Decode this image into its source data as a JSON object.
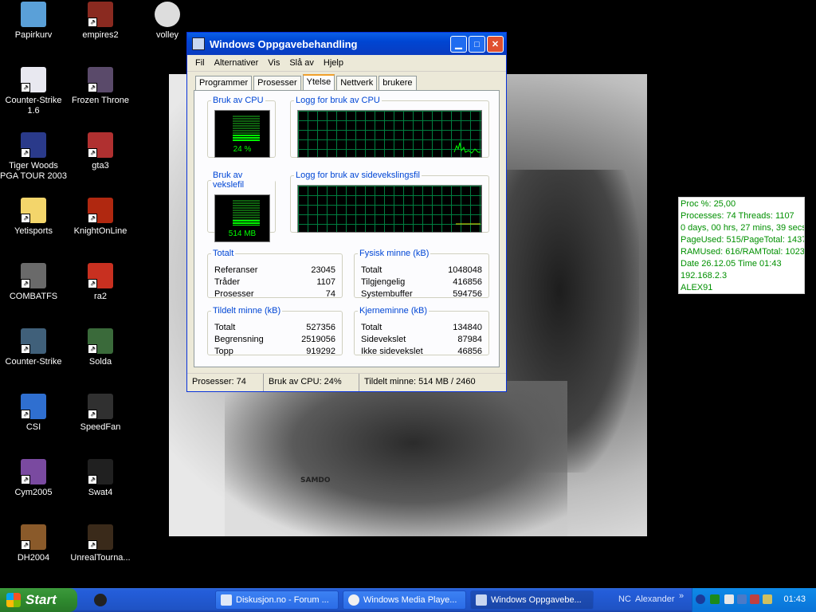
{
  "desktop": {
    "icons": [
      {
        "label": "Papirkurv",
        "icon": "recycle-bin-icon",
        "color": "#5aa0d8"
      },
      {
        "label": "empires2",
        "icon": "helmet-icon",
        "color": "#8a2a20"
      },
      {
        "label": "volley",
        "icon": "volleyball-icon",
        "color": "#dddddd"
      },
      {
        "label": "Counter-Strike 1.6",
        "icon": "document-icon",
        "color": "#e8e8f0"
      },
      {
        "label": "Frozen Throne",
        "icon": "frozen-throne-icon",
        "color": "#5a4a6a"
      },
      {
        "label": "Tiger Woods PGA TOUR 2003",
        "icon": "golf-icon",
        "color": "#2a3a8a"
      },
      {
        "label": "gta3",
        "icon": "gta-icon",
        "color": "#b03030"
      },
      {
        "label": "Yetisports",
        "icon": "folder-icon",
        "color": "#f3d56b"
      },
      {
        "label": "KnightOnLine",
        "icon": "knight-icon",
        "color": "#b02810"
      },
      {
        "label": "COMBATFS",
        "icon": "airplane-icon",
        "color": "#6a6a6a"
      },
      {
        "label": "ra2",
        "icon": "hammer-sickle-icon",
        "color": "#c83020"
      },
      {
        "label": "Counter-Strike",
        "icon": "soldier-icon",
        "color": "#40607a"
      },
      {
        "label": "Solda",
        "icon": "soldat-icon",
        "color": "#3a6a3a"
      },
      {
        "label": "CSI",
        "icon": "fingerprint-icon",
        "color": "#2f6fd0"
      },
      {
        "label": "SpeedFan",
        "icon": "fan-icon",
        "color": "#303030"
      },
      {
        "label": "Cym2005",
        "icon": "gymnast-icon",
        "color": "#7a4aa0"
      },
      {
        "label": "Swat4",
        "icon": "swat-icon",
        "color": "#202020"
      },
      {
        "label": "DH2004",
        "icon": "deer-hunter-icon",
        "color": "#8a5a2a"
      },
      {
        "label": "UnrealTourna...",
        "icon": "unreal-icon",
        "color": "#3a2a1a"
      }
    ],
    "wallpaper_signature": "SAMDO"
  },
  "taskmanager": {
    "title": "Windows Oppgavebehandling",
    "menu": [
      "Fil",
      "Alternativer",
      "Vis",
      "Slå av",
      "Hjelp"
    ],
    "tabs": [
      "Programmer",
      "Prosesser",
      "Ytelse",
      "Nettverk",
      "brukere"
    ],
    "active_tab": "Ytelse",
    "cpu": {
      "label": "Bruk av CPU",
      "value": "24 %",
      "percent": 24
    },
    "cpu_history": {
      "label": "Logg for bruk av CPU"
    },
    "pagefile": {
      "label": "Bruk av vekslefil",
      "value": "514 MB",
      "fraction": 0.21
    },
    "pagefile_history": {
      "label": "Logg for bruk av sidevekslingsfil"
    },
    "totals": {
      "label": "Totalt",
      "rows": [
        {
          "name": "Referanser",
          "value": "23045"
        },
        {
          "name": "Tråder",
          "value": "1107"
        },
        {
          "name": "Prosesser",
          "value": "74"
        }
      ]
    },
    "physical": {
      "label": "Fysisk minne (kB)",
      "rows": [
        {
          "name": "Totalt",
          "value": "1048048"
        },
        {
          "name": "Tilgjengelig",
          "value": "416856"
        },
        {
          "name": "Systembuffer",
          "value": "594756"
        }
      ]
    },
    "commit": {
      "label": "Tildelt minne (kB)",
      "rows": [
        {
          "name": "Totalt",
          "value": "527356"
        },
        {
          "name": "Begrensning",
          "value": "2519056"
        },
        {
          "name": "Topp",
          "value": "919292"
        }
      ]
    },
    "kernel": {
      "label": "Kjerneminne (kB)",
      "rows": [
        {
          "name": "Totalt",
          "value": "134840"
        },
        {
          "name": "Sidevekslet",
          "value": "87984"
        },
        {
          "name": "Ikke sidevekslet",
          "value": "46856"
        }
      ]
    },
    "status": {
      "processes": "Prosesser: 74",
      "cpu": "Bruk av CPU: 24%",
      "commit": "Tildelt minne: 514 MB / 2460"
    }
  },
  "monitor": {
    "lines": [
      "Proc %: 25,00",
      "Processes: 74   Threads: 1107",
      "0 days, 00 hrs, 27 mins, 39 secs",
      "PageUsed: 515/PageTotal: 1437",
      "RAMUsed: 616/RAMTotal: 1023",
      "Date 26.12.05 Time 01:43",
      "192.168.2.3",
      "ALEX91"
    ],
    "text_color": "#009000"
  },
  "taskbar": {
    "start_label": "Start",
    "buttons": [
      {
        "label": "Diskusjon.no - Forum ...",
        "icon": "browser-icon",
        "active": false
      },
      {
        "label": "Windows Media Playe...",
        "icon": "media-player-icon",
        "active": false
      },
      {
        "label": "Windows Oppgavebe...",
        "icon": "task-manager-icon",
        "active": true
      }
    ],
    "nc_label": "NC",
    "user_label": "Alexander",
    "chevron": "»",
    "clock": "01:43"
  }
}
